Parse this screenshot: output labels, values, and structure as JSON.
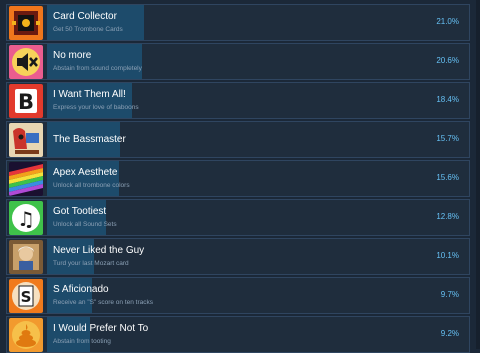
{
  "achievements": [
    {
      "title": "Card Collector",
      "description": "Get 50 Trombone Cards",
      "percent": "21.0%",
      "percent_value": 21.0,
      "icon": "card-collector-icon"
    },
    {
      "title": "No more",
      "description": "Abstain from sound completely",
      "percent": "20.6%",
      "percent_value": 20.6,
      "icon": "mute-icon"
    },
    {
      "title": "I Want Them All!",
      "description": "Express your love of baboons",
      "percent": "18.4%",
      "percent_value": 18.4,
      "icon": "letter-b-icon"
    },
    {
      "title": "The Bassmaster",
      "description": "",
      "percent": "15.7%",
      "percent_value": 15.7,
      "icon": "bassmaster-icon"
    },
    {
      "title": "Apex Aesthete",
      "description": "Unlock all trombone colors",
      "percent": "15.6%",
      "percent_value": 15.6,
      "icon": "rainbow-trombone-icon"
    },
    {
      "title": "Got Tootiest",
      "description": "Unlock all Sound Sets",
      "percent": "12.8%",
      "percent_value": 12.8,
      "icon": "music-notes-icon"
    },
    {
      "title": "Never Liked the Guy",
      "description": "Turd your last Mozart card",
      "percent": "10.1%",
      "percent_value": 10.1,
      "icon": "mozart-portrait-icon"
    },
    {
      "title": "S Aficionado",
      "description": "Receive an \"S\" score on ten tracks",
      "percent": "9.7%",
      "percent_value": 9.7,
      "icon": "s-score-icon"
    },
    {
      "title": "I Would Prefer Not To",
      "description": "Abstain from tooting",
      "percent": "9.2%",
      "percent_value": 9.2,
      "icon": "turd-icon"
    }
  ],
  "colors": {
    "background": "#1b2838",
    "row": "#1f2d3d",
    "progress_bar": "#1d4b6b",
    "percent_text": "#66c0f4"
  }
}
